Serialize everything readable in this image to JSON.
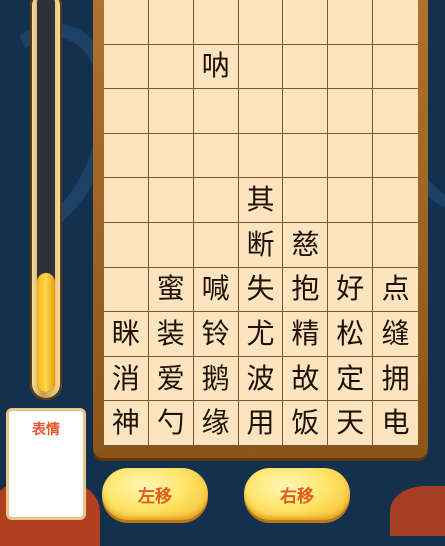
{
  "progress": {
    "fill_fraction": 0.3
  },
  "emoji": {
    "label": "表情"
  },
  "board": {
    "rows": [
      [
        "",
        "",
        "",
        "",
        "",
        "",
        ""
      ],
      [
        "",
        "",
        "呐",
        "",
        "",
        "",
        ""
      ],
      [
        "",
        "",
        "",
        "",
        "",
        "",
        ""
      ],
      [
        "",
        "",
        "",
        "",
        "",
        "",
        ""
      ],
      [
        "",
        "",
        "",
        "其",
        "",
        "",
        ""
      ],
      [
        "",
        "",
        "",
        "断",
        "慈",
        "",
        ""
      ],
      [
        "",
        "蜜",
        "喊",
        "失",
        "抱",
        "好",
        "点"
      ],
      [
        "眯",
        "装",
        "铃",
        "尤",
        "精",
        "松",
        "缝"
      ],
      [
        "消",
        "爱",
        "鹅",
        "波",
        "故",
        "定",
        "拥"
      ],
      [
        "神",
        "勺",
        "缘",
        "用",
        "饭",
        "天",
        "电"
      ]
    ]
  },
  "controls": {
    "left_label": "左移",
    "right_label": "右移"
  }
}
